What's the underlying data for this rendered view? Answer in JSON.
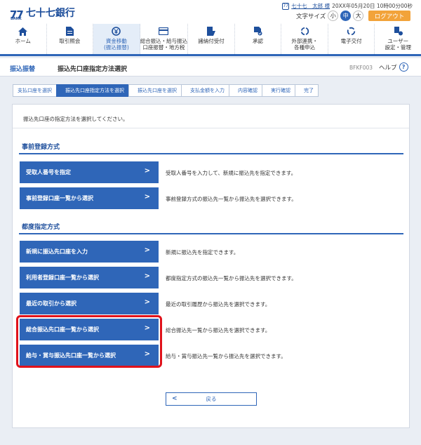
{
  "header": {
    "logo_mark": "77",
    "logo_sub": "BANK",
    "bank_name": "七十七銀行",
    "user_name": "七十七　太郎 様",
    "datetime": "20XX年05月20日 10時00分00秒",
    "font_size_label": "文字サイズ",
    "font_sizes": [
      "小",
      "中",
      "大"
    ],
    "logout_label": "ログアウト",
    "accent_color": "#2f66b8",
    "logout_color": "#f2a33a"
  },
  "nav": {
    "items": [
      {
        "label": "ホーム",
        "icon": "home-icon"
      },
      {
        "label": "取引照会",
        "icon": "document-icon"
      },
      {
        "label": "資金移動\n(振込振替)",
        "icon": "yen-transfer-icon",
        "active": true
      },
      {
        "label": "総合振込・給与振込\n口座振替・地方税",
        "icon": "card-icon"
      },
      {
        "label": "諸納付受付",
        "icon": "payment-icon"
      },
      {
        "label": "承認",
        "icon": "approval-icon"
      },
      {
        "label": "外部連携・\n各種申込",
        "icon": "link-icon"
      },
      {
        "label": "電子交付",
        "icon": "refresh-icon"
      },
      {
        "label": "ユーザー\n設定・管理",
        "icon": "user-settings-icon"
      }
    ]
  },
  "titlebar": {
    "crumb": "振込振替",
    "title": "振込先口座指定方法選択",
    "screen_id": "BFKF003",
    "help_label": "ヘルプ"
  },
  "steps": [
    "支払口座を選択",
    "振込先口座指定方法を選択",
    "振込先口座を選択",
    "支払金額を入力",
    "内容確認",
    "実行確認",
    "完了"
  ],
  "main": {
    "intro": "振込先口座の指定方法を選択してください。",
    "section1_title": "事前登録方式",
    "section1_options": [
      {
        "label": "受取人番号を指定",
        "desc": "受取人番号を入力して、新規に振込先を指定できます。"
      },
      {
        "label": "事前登録口座一覧から選択",
        "desc": "事前登録方式の振込先一覧から振込先を選択できます。"
      }
    ],
    "section2_title": "都度指定方式",
    "section2_options": [
      {
        "label": "新規に振込先口座を入力",
        "desc": "新規に振込先を指定できます。"
      },
      {
        "label": "利用者登録口座一覧から選択",
        "desc": "都度指定方式の振込先一覧から振込先を選択できます。"
      },
      {
        "label": "最近の取引から選択",
        "desc": "最近の取引履歴から振込先を選択できます。"
      },
      {
        "label": "総合振込先口座一覧から選択",
        "desc": "総合振込先一覧から振込先を選択できます。"
      },
      {
        "label": "給与・賞与振込先口座一覧から選択",
        "desc": "給与・賞与振込先一覧から振込先を選択できます。"
      }
    ],
    "back_label": "戻る",
    "highlight_color": "#e0121b"
  }
}
